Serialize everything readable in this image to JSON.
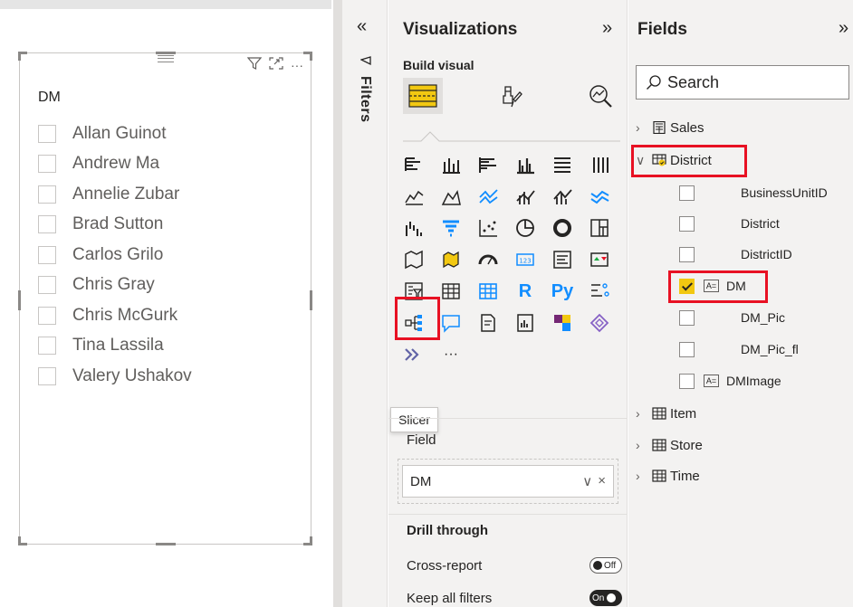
{
  "slicer": {
    "title": "DM",
    "items": [
      "Allan Guinot",
      "Andrew Ma",
      "Annelie Zubar",
      "Brad Sutton",
      "Carlos Grilo",
      "Chris Gray",
      "Chris McGurk",
      "Tina Lassila",
      "Valery Ushakov"
    ],
    "header_icons": [
      "filter-icon",
      "focus-mode-icon",
      "more-options-icon"
    ],
    "more_glyph": "···"
  },
  "filters": {
    "label": "Filters",
    "collapse_glyph": "«"
  },
  "visualizations": {
    "title": "Visualizations",
    "expand_glyph": "»",
    "build_label": "Build visual",
    "tooltip": "Slicer",
    "more_glyph": "···",
    "field_well_label": "Field",
    "field_value": "DM",
    "field_dropdown_glyph": "∨",
    "field_remove_glyph": "×",
    "r_glyph": "R",
    "py_glyph": "Py",
    "drill_label": "Drill through",
    "cross_report_label": "Cross-report",
    "cross_report_state": "Off",
    "keep_filters_label": "Keep all filters",
    "keep_filters_state": "On"
  },
  "fields": {
    "title": "Fields",
    "expand_glyph": "»",
    "search_placeholder": "Search",
    "tables": [
      {
        "name": "Sales",
        "expanded": false
      },
      {
        "name": "District",
        "expanded": true
      },
      {
        "name": "Item",
        "expanded": false
      },
      {
        "name": "Store",
        "expanded": false
      },
      {
        "name": "Time",
        "expanded": false
      }
    ],
    "district_fields": [
      {
        "name": "BusinessUnitID",
        "checked": false,
        "hierarchy": false
      },
      {
        "name": "District",
        "checked": false,
        "hierarchy": false
      },
      {
        "name": "DistrictID",
        "checked": false,
        "hierarchy": false
      },
      {
        "name": "DM",
        "checked": true,
        "hierarchy": true
      },
      {
        "name": "DM_Pic",
        "checked": false,
        "hierarchy": false
      },
      {
        "name": "DM_Pic_fl",
        "checked": false,
        "hierarchy": false
      },
      {
        "name": "DMImage",
        "checked": false,
        "hierarchy": true
      }
    ],
    "hierarchy_glyph": "A="
  },
  "colors": {
    "highlight": "#e81123",
    "checked": "#f2c811",
    "pane_bg": "#f3f2f1"
  }
}
